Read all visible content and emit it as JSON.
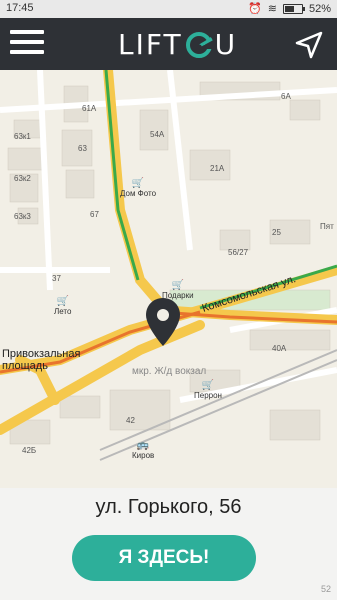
{
  "status": {
    "time": "17:45",
    "battery": "52%",
    "battery_level": 0.52
  },
  "app": {
    "logo_left": "LIFT",
    "logo_right": "U"
  },
  "map": {
    "buildings": [
      "6А",
      "61А",
      "63",
      "54А",
      "63к1",
      "63к2",
      "63к3",
      "67",
      "21А",
      "37",
      "25",
      "Пят",
      "56/27",
      "40А",
      "42",
      "42Б"
    ],
    "pois": [
      "Дом Фото",
      "Подарки",
      "Лето",
      "Перрон",
      "Киров"
    ],
    "street": "Комсомольская ул.",
    "square": "Привокзальная\nплощадь",
    "station": "мкр. Ж/д вокзал"
  },
  "bottom": {
    "address": "ул. Горького, 56",
    "button": "Я ЗДЕСЬ!",
    "corner_num": "52"
  }
}
